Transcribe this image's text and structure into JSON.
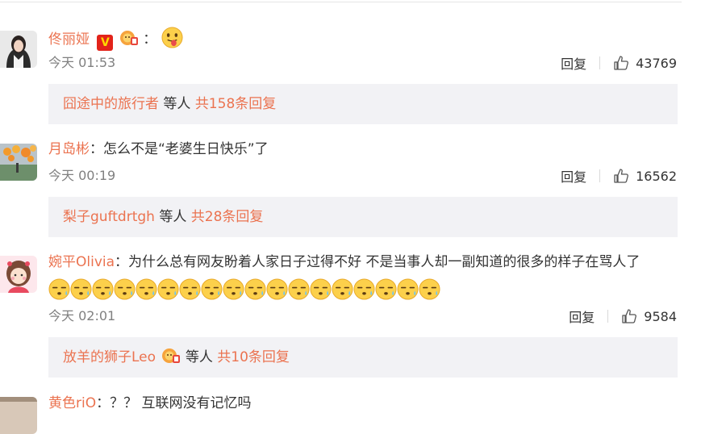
{
  "comments": [
    {
      "username": "佟丽娅",
      "colon": "：",
      "text": "",
      "has_v_badge": true,
      "v_badge_text": "V",
      "has_lion_badge": true,
      "emoji": "tongue-out-emoji",
      "time": "今天 01:53",
      "reply_label": "回复",
      "likes": "43769",
      "reply_summary": {
        "first_user": "囧途中的旅行者",
        "middle": " 等人 ",
        "total": "共158条回复",
        "has_lion_badge": false
      }
    },
    {
      "username": "月岛彬",
      "colon": "：",
      "text": "怎么不是“老婆生日快乐”了",
      "time": "今天 00:19",
      "reply_label": "回复",
      "likes": "16562",
      "reply_summary": {
        "first_user": "梨子guftdrtgh",
        "middle": " 等人 ",
        "total": "共28条回复",
        "has_lion_badge": false
      }
    },
    {
      "username": "婉平Olivia",
      "colon": "：",
      "text": "为什么总有网友盼着人家日子过得不好 不是当事人却一副知道的很多的样子在骂人了",
      "emoji_count": 18,
      "emoji": "sweat-speechless-emoji",
      "time": "今天 02:01",
      "reply_label": "回复",
      "likes": "9584",
      "reply_summary": {
        "first_user": "放羊的狮子Leo",
        "middle": " 等人 ",
        "total": "共10条回复",
        "has_lion_badge": true
      }
    },
    {
      "username": "黄色riO",
      "colon": "：",
      "text": "？？ 互联网没有记忆吗"
    }
  ],
  "colors": {
    "accent": "#eb7350",
    "reply_bg": "#f2f2f5",
    "time": "#808080"
  }
}
